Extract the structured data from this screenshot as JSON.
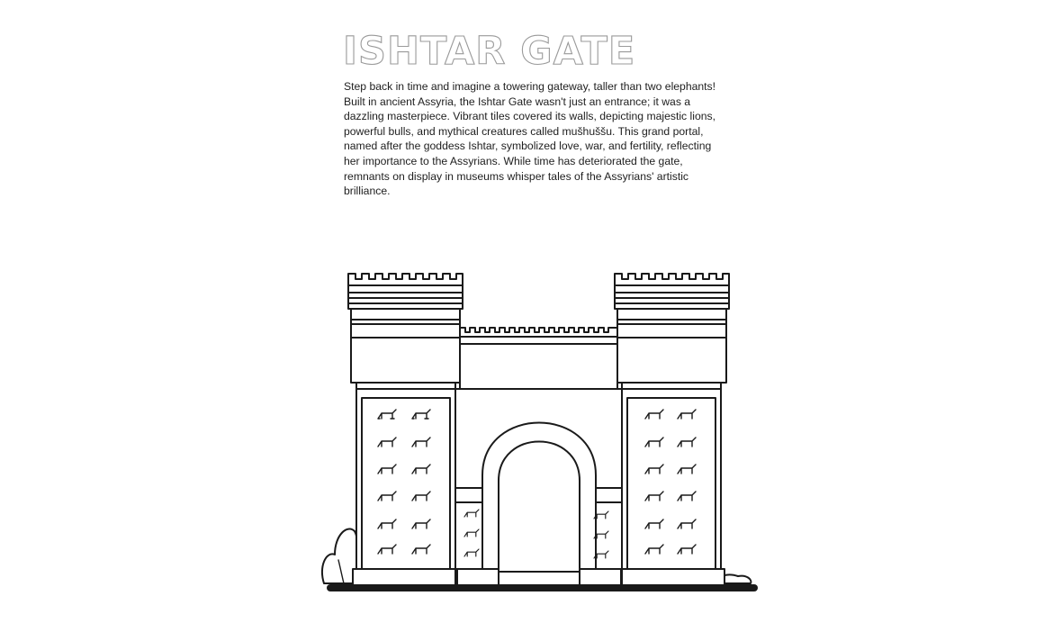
{
  "title": "ISHTAR GATE",
  "description": "Step back in time and imagine a towering gateway, taller than two elephants! Built in ancient Assyria, the Ishtar Gate wasn't just an entrance; it was a dazzling masterpiece. Vibrant tiles covered its walls, depicting majestic lions, powerful bulls, and mythical creatures called mušhuššu. This grand portal, named after the goddess Ishtar, symbolized love, war, and fertility, reflecting her importance to the Assyrians. While time has deteriorated the gate, remnants on display in museums whisper tales of the Assyrians' artistic brilliance.",
  "illustration": {
    "subject": "ishtar-gate-line-drawing",
    "style": "black outline coloring page"
  }
}
